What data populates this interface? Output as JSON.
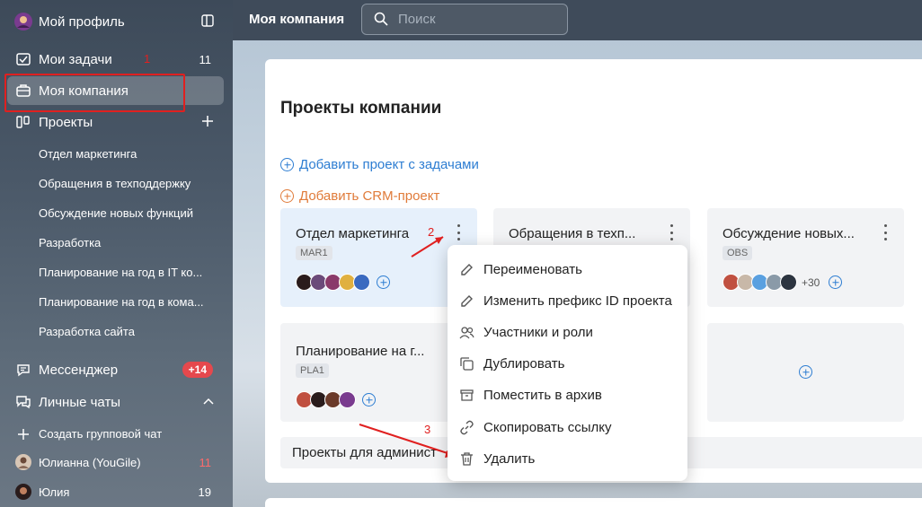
{
  "sidebar": {
    "profile": {
      "label": "Мой профиль"
    },
    "tasks": {
      "label": "Мои задачи",
      "count": "11"
    },
    "company": {
      "label": "Моя компания"
    },
    "projects": {
      "label": "Проекты",
      "items": [
        {
          "label": "Отдел маркетинга"
        },
        {
          "label": "Обращения в техподдержку"
        },
        {
          "label": "Обсуждение новых функций"
        },
        {
          "label": "Разработка"
        },
        {
          "label": "Планирование на год в IT ко..."
        },
        {
          "label": "Планирование на год в кома..."
        },
        {
          "label": "Разработка сайта"
        }
      ]
    },
    "messenger": {
      "label": "Мессенджер",
      "badge": "+14"
    },
    "personal_chats": {
      "label": "Личные чаты"
    },
    "create_group": {
      "label": "Создать групповой чат"
    },
    "chats": [
      {
        "label": "Юлианна (YouGile)",
        "count": "11"
      },
      {
        "label": "Юлия",
        "count": "19"
      }
    ]
  },
  "annotations": {
    "one": "1",
    "two": "2",
    "three": "3"
  },
  "topbar": {
    "title": "Моя компания",
    "search_placeholder": "Поиск"
  },
  "main": {
    "title": "Проекты компании",
    "add_project": "Добавить проект с задачами",
    "add_crm": "Добавить CRM-проект",
    "cards": [
      {
        "title": "Отдел маркетинга",
        "prefix": "MAR1"
      },
      {
        "title": "Обращения в техп...",
        "prefix": ""
      },
      {
        "title": "Обсуждение новых...",
        "prefix": "OBS",
        "extra": "+30"
      },
      {
        "title": "Планирование на г...",
        "prefix": "PLA1"
      }
    ],
    "admin_projects": "Проекты для админист"
  },
  "context_menu": {
    "items": [
      {
        "label": "Переименовать",
        "icon": "pencil-icon"
      },
      {
        "label": "Изменить префикс ID проекта",
        "icon": "pencil-icon"
      },
      {
        "label": "Участники и роли",
        "icon": "users-icon"
      },
      {
        "label": "Дублировать",
        "icon": "copy-icon"
      },
      {
        "label": "Поместить в архив",
        "icon": "archive-icon"
      },
      {
        "label": "Скопировать ссылку",
        "icon": "link-icon"
      },
      {
        "label": "Удалить",
        "icon": "trash-icon"
      }
    ]
  },
  "colors": {
    "accent_blue": "#2d7dd2",
    "accent_orange": "#e07b3a",
    "annotation_red": "#e02020",
    "badge_red": "#e5484d"
  }
}
